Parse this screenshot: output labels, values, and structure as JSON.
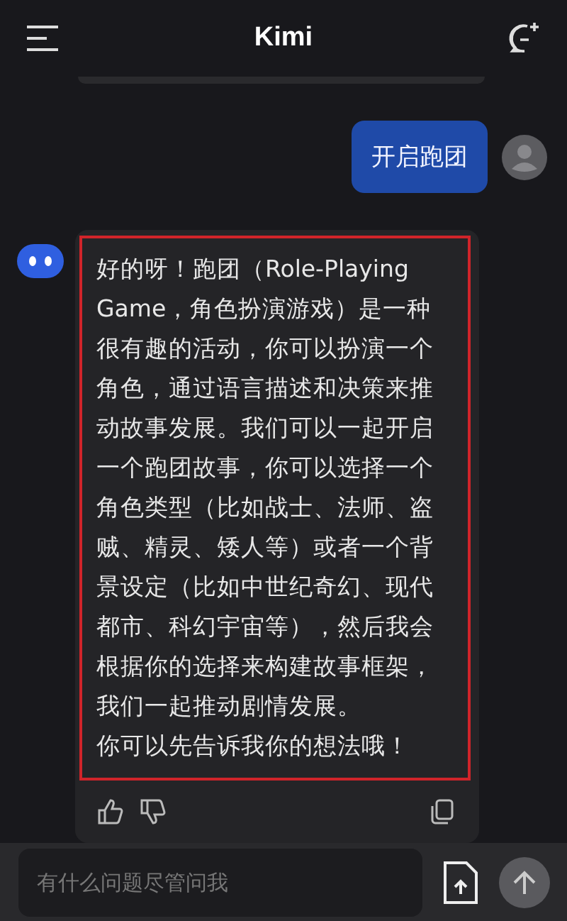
{
  "header": {
    "title": "Kimi"
  },
  "messages": [
    {
      "kind": "user",
      "text": "开启跑团"
    },
    {
      "kind": "assistant",
      "highlighted": true,
      "paragraphs": [
        "好的呀！跑团（Role-Playing Game，角色扮演游戏）是一种很有趣的活动，你可以扮演一个角色，通过语言描述和决策来推动故事发展。我们可以一起开启一个跑团故事，你可以选择一个角色类型（比如战士、法师、盗贼、精灵、矮人等）或者一个背景设定（比如中世纪奇幻、现代都市、科幻宇宙等），然后我会根据你的选择来构建故事框架，我们一起推动剧情发展。",
        "你可以先告诉我你的想法哦！"
      ]
    }
  ],
  "composer": {
    "placeholder": "有什么问题尽管问我",
    "send_disabled": true
  }
}
